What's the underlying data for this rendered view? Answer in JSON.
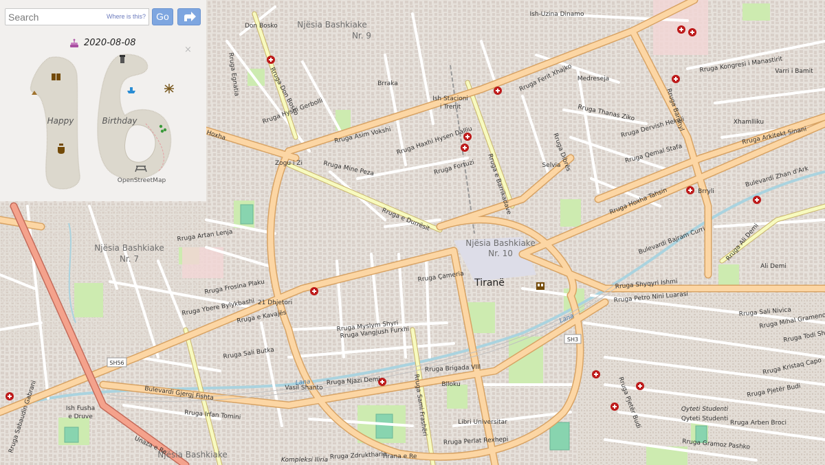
{
  "search": {
    "placeholder": "Search",
    "value": "",
    "where_link": "Where is this?",
    "go_label": "Go"
  },
  "panel": {
    "date": "2020-08-08",
    "art_words": [
      "Happy",
      "Birthday"
    ],
    "art_credit": "OpenStreetMap",
    "close_glyph": "×"
  },
  "map": {
    "city": "Tiranë",
    "areas": [
      "Njësia Bashkiake Nr. 9",
      "Njësia Bashkiake Nr. 10",
      "Njësia Bashkiake Nr. 7",
      "Njësia Bashkiake",
      "Don Bosko",
      "Medreseja",
      "Selvia",
      "Brryli",
      "Ali Demi",
      "Xhamlliku",
      "Varri i Bamit",
      "Ish-Uzina Dinamo",
      "Ish Stacioni i Trenit",
      "Zogu i Zi",
      "21 Dhjetori",
      "Vasil Shanto",
      "Blloku",
      "Libri Universitar",
      "Ish Fusha e Druve",
      "Qyteti Studenti",
      "Brraka",
      "Tirana e Re",
      "Kompleksi Iliria"
    ],
    "streets": [
      "Rruga Ferit Xhajko",
      "Rruga Asim Vokshi",
      "Rruga Mine Peza",
      "Rruga e Durrësit",
      "Rruga e Barrikadave",
      "Rruga Sami Frashëri",
      "Rruga Don Bosko",
      "Bulevardi Gjergj Fishta",
      "Bulevardi Bajram Curri",
      "Bulevardi Zhan d'Ark",
      "Rruga Hoxha Tahsin",
      "Rruga Bardhyl",
      "Rruga Ali Demi",
      "Rruga Myslym Shyri",
      "Rruga Vangjush Furxhi",
      "Rruga e Kavajës",
      "Unaza e Re",
      "Rruga Sali Butka",
      "Rruga Artan Lenja",
      "Rruga Frosina Plaku",
      "Rruga Ybere Bylykbashi",
      "Rruga Irfan Tomini",
      "Rruga Dibrës",
      "Rruga Kongresi i Manastirit",
      "Rruga Njazi Demi",
      "Rruga Brigada VIII",
      "Rruga Perlat Rexhepi",
      "Rruga Kongresi i Manastirit",
      "Rruga Sulejman Delvina",
      "Rruga Petro Nini Luarasi",
      "Rruga Pjetër Budi",
      "Rruga Gramoz Pashko",
      "Rruga Arben Broci",
      "Rruga Sali Nivica",
      "Rruga Mihal Grameno",
      "Rruga Todi Shkurti",
      "Rruga Kristaq Capo",
      "Rruga Jorgji Truja",
      "Rruga Shyqyri Ishmi",
      "Rruga Egnatia",
      "Rruga Elbasanit",
      "Rruga Qemal Stafa",
      "Rruga Hysni Gerbolli",
      "Rruga Haxhi Hysen Dalliu",
      "Rruga Fortuzi",
      "Rruga Nikolla Tupe",
      "Rruga Zdruktharia",
      "Rruga Dervish Hekali",
      "Rruga Thanas Ziko",
      "Rruga Hoxha",
      "Rruga Kavajës",
      "Rruga Sabaudin Gabrani"
    ],
    "road_refs": [
      "SH56",
      "SH3"
    ],
    "waterways": [
      "Lana",
      "Lana"
    ]
  }
}
